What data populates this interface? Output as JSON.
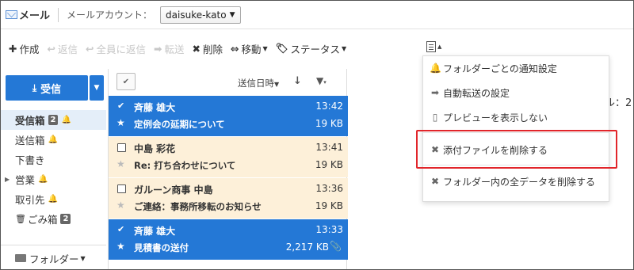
{
  "header": {
    "app_title": "メール",
    "account_label": "メールアカウント：",
    "account_value": "daisuke-kato"
  },
  "toolbar": {
    "compose": "作成",
    "reply": "返信",
    "reply_all": "全員に返信",
    "forward": "転送",
    "delete": "削除",
    "move": "移動",
    "status": "ステータス"
  },
  "nav": {
    "receive_button": "受信",
    "items": [
      {
        "label": "受信箱",
        "badge": "2",
        "bell": true,
        "active": true
      },
      {
        "label": "送信箱",
        "badge": "",
        "bell": true,
        "active": false
      },
      {
        "label": "下書き",
        "badge": "",
        "bell": false,
        "active": false
      },
      {
        "label": "営業",
        "badge": "",
        "bell": true,
        "active": false,
        "expandable": true
      },
      {
        "label": "取引先",
        "badge": "",
        "bell": true,
        "active": false
      },
      {
        "label": "ごみ箱",
        "badge": "2",
        "bell": false,
        "active": false,
        "trash": true
      }
    ],
    "folder_menu": "フォルダー"
  },
  "list": {
    "sort_label": "送信日時",
    "rows": [
      {
        "from": "斉藤 雄大",
        "time": "13:42",
        "subject": "定例会の延期について",
        "size": "19 KB",
        "state": "selected",
        "attachment": false
      },
      {
        "from": "中島 彩花",
        "time": "13:41",
        "subject": "Re: 打ち合わせについて",
        "size": "19 KB",
        "state": "unread",
        "attachment": false
      },
      {
        "from": "ガルーン商事 中島",
        "time": "13:36",
        "subject": "ご連絡：事務所移転のお知らせ",
        "size": "19 KB",
        "state": "unread",
        "attachment": false
      },
      {
        "from": "斉藤 雄大",
        "time": "13:33",
        "subject": "見積書の送付",
        "size": "2,217 KB",
        "state": "selected",
        "attachment": true
      }
    ]
  },
  "right_pane": {
    "partial_text": "ル：2"
  },
  "menu": {
    "items": [
      {
        "label": "フォルダーごとの通知設定",
        "icon": "bell-icon"
      },
      {
        "label": "自動転送の設定",
        "icon": "arrow-right-icon"
      },
      {
        "label": "プレビューを表示しない",
        "icon": "preview-pane-icon"
      },
      {
        "label": "添付ファイルを削除する",
        "icon": "x-icon"
      },
      {
        "label": "フォルダー内の全データを削除する",
        "icon": "x-icon"
      }
    ]
  },
  "colors": {
    "accent": "#2478d6",
    "unread_bg": "#fdf0d9",
    "highlight": "#e1252a"
  }
}
